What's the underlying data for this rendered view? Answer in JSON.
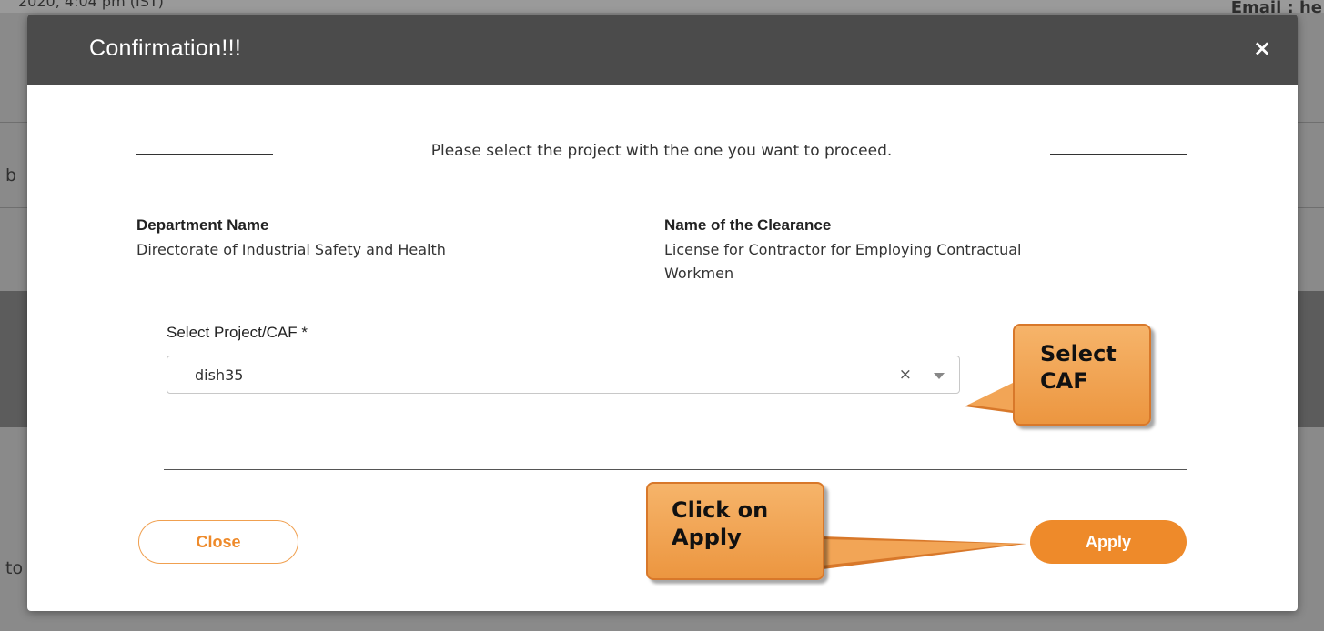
{
  "background": {
    "top_left_fragment": "2020, 4:04 pm (IST)",
    "top_right_fragment": "Email : he",
    "left_fragment_b": "b",
    "left_fragment_to": "to"
  },
  "modal": {
    "title": "Confirmation!!!",
    "close_icon_glyph": "×",
    "instruction": "Please select the project with the one you want to proceed.",
    "department_label": "Department Name",
    "department_value": "Directorate of Industrial Safety and Health",
    "clearance_label": "Name of the Clearance",
    "clearance_value": "License for Contractor for Employing Contractual Workmen",
    "select_label": "Select Project/CAF *",
    "select_value": "dish35",
    "select_clear_glyph": "×",
    "close_button": "Close",
    "apply_button": "Apply"
  },
  "callouts": {
    "select_caf": "Select CAF",
    "click_apply": "Click on Apply"
  },
  "colors": {
    "header_bg": "#4b4b4b",
    "accent_orange": "#ee8a2a",
    "callout_orange": "#f6b46a"
  }
}
